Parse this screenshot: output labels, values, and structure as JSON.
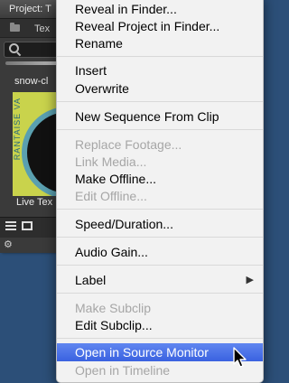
{
  "project_panel": {
    "title": "Project: T",
    "tab_label": "Tex",
    "clip_name": "snow-cl",
    "thumbnail_text": "RANTAISE VA",
    "live_text_label": "Live Tex",
    "icons": [
      "folder-icon",
      "search-icon",
      "list-view-icon",
      "icon-view-icon",
      "settings-icon"
    ]
  },
  "context_menu": {
    "items": [
      {
        "label": "Reveal in Finder...",
        "enabled": true
      },
      {
        "label": "Reveal Project in Finder...",
        "enabled": true
      },
      {
        "label": "Rename",
        "enabled": true
      },
      {
        "label": "Insert",
        "enabled": true
      },
      {
        "label": "Overwrite",
        "enabled": true
      },
      {
        "label": "New Sequence From Clip",
        "enabled": true
      },
      {
        "label": "Replace Footage...",
        "enabled": false
      },
      {
        "label": "Link Media...",
        "enabled": false
      },
      {
        "label": "Make Offline...",
        "enabled": true
      },
      {
        "label": "Edit Offline...",
        "enabled": false
      },
      {
        "label": "Speed/Duration...",
        "enabled": true
      },
      {
        "label": "Audio Gain...",
        "enabled": true
      },
      {
        "label": "Label",
        "enabled": true,
        "submenu": true
      },
      {
        "label": "Make Subclip",
        "enabled": false
      },
      {
        "label": "Edit Subclip...",
        "enabled": true
      },
      {
        "label": "Open in Source Monitor",
        "enabled": true,
        "highlighted": true
      },
      {
        "label": "Open in Timeline",
        "enabled": false
      }
    ],
    "submenu_arrow_glyph": "▶"
  },
  "colors": {
    "menu_background": "#f2f2f2",
    "highlight": "#3a62e0",
    "disabled_text": "#a6a6a6",
    "desktop_background": "#2c4f78"
  }
}
